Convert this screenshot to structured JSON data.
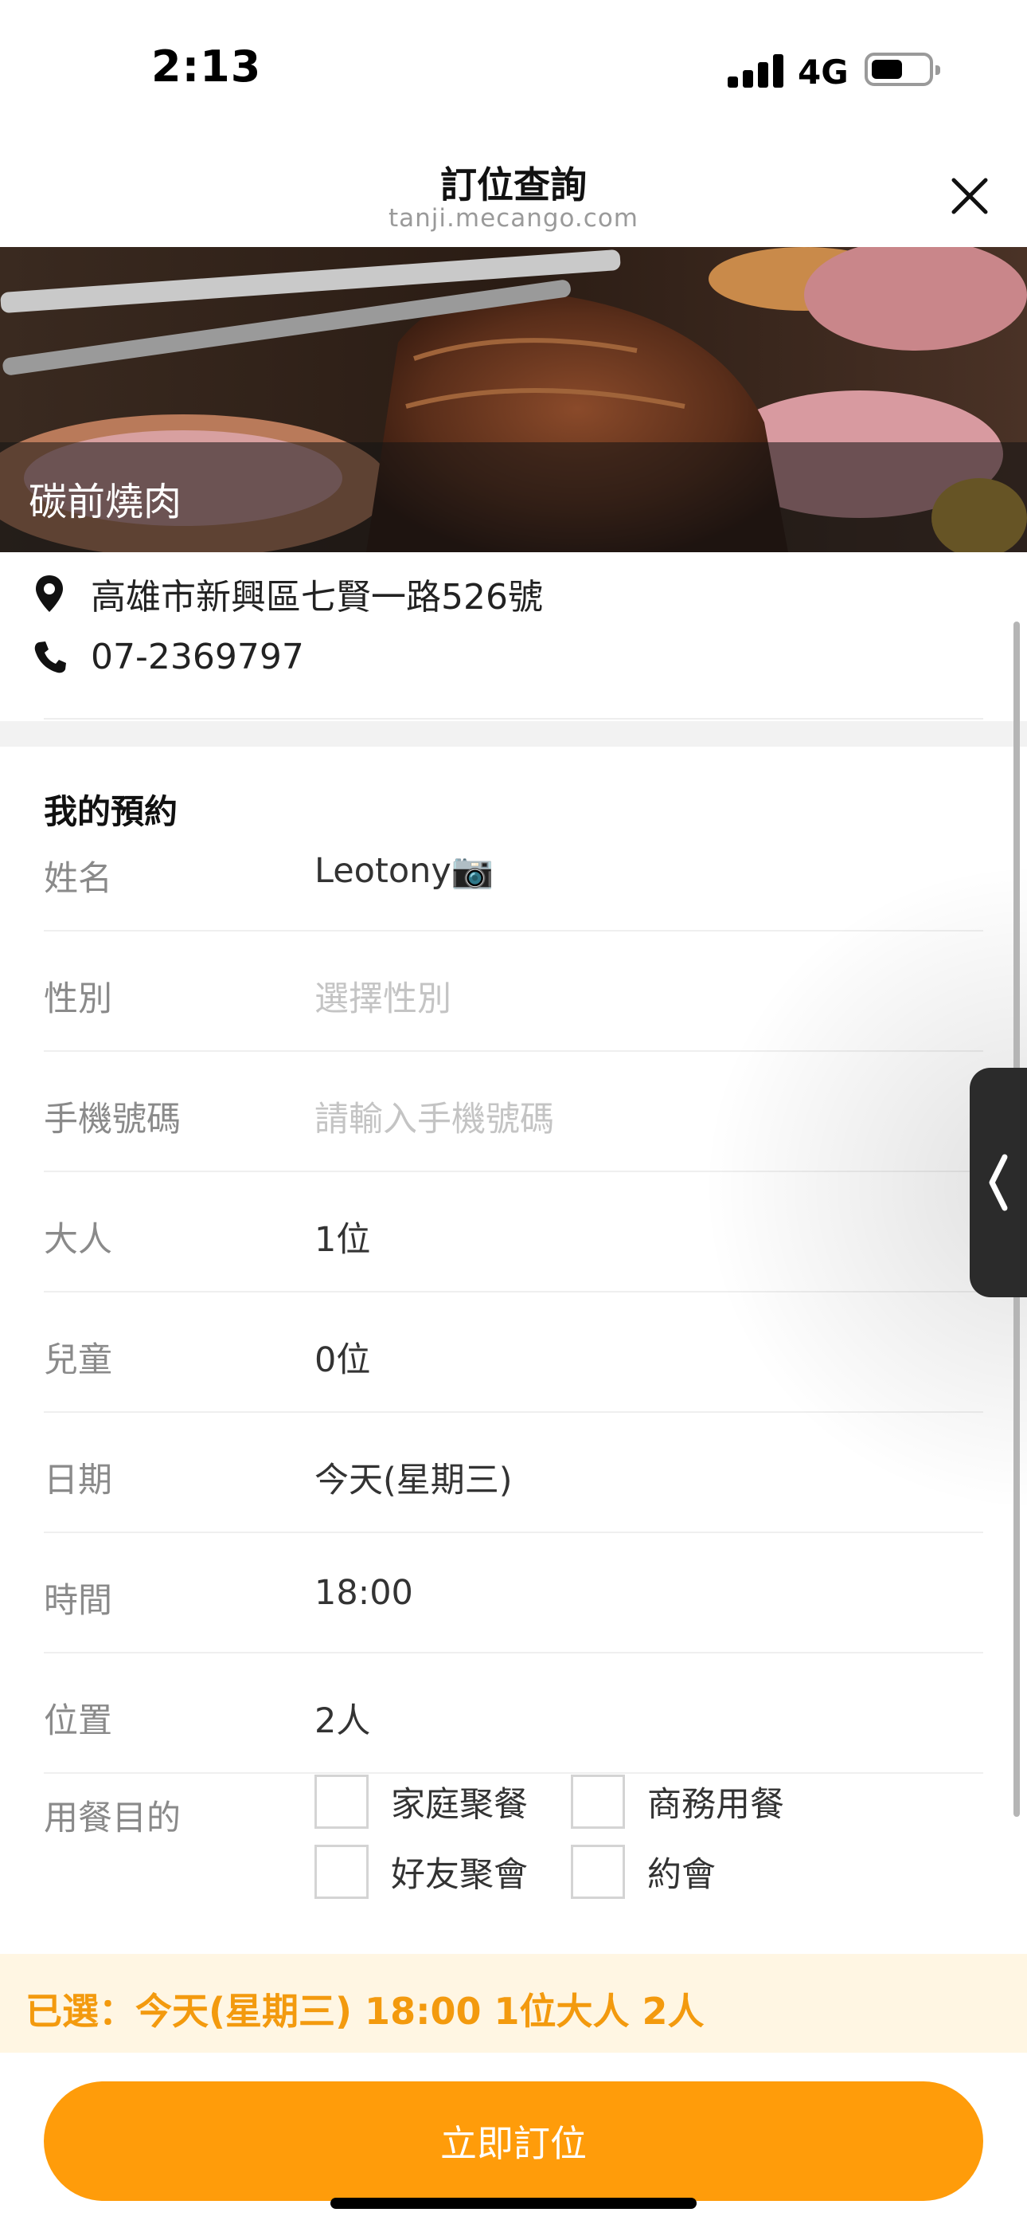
{
  "status_bar": {
    "time": "2:13",
    "network": "4G"
  },
  "header": {
    "title": "訂位查詢",
    "url": "tanji.mecango.com"
  },
  "restaurant": {
    "name": "碳前燒肉",
    "address": "高雄市新興區七賢一路526號",
    "phone": "07-2369797"
  },
  "reservation": {
    "section_title": "我的預約",
    "fields": [
      {
        "label": "姓名",
        "value": "Leotony📷",
        "placeholder": false
      },
      {
        "label": "性別",
        "value": "選擇性別",
        "placeholder": true
      },
      {
        "label": "手機號碼",
        "value": "請輸入手機號碼",
        "placeholder": true
      },
      {
        "label": "大人",
        "value": "1位",
        "placeholder": false
      },
      {
        "label": "兒童",
        "value": "0位",
        "placeholder": false
      },
      {
        "label": "日期",
        "value": "今天(星期三)",
        "placeholder": false
      },
      {
        "label": "時間",
        "value": "18:00",
        "placeholder": false
      },
      {
        "label": "位置",
        "value": "2人",
        "placeholder": false
      }
    ],
    "purpose": {
      "label": "用餐目的",
      "options": [
        {
          "label": "家庭聚餐",
          "checked": false
        },
        {
          "label": "商務用餐",
          "checked": false
        },
        {
          "label": "好友聚會",
          "checked": false
        },
        {
          "label": "約會",
          "checked": false
        }
      ]
    }
  },
  "summary": {
    "text": "已選：今天(星期三) 18:00 1位大人 2人"
  },
  "cta": {
    "label": "立即訂位"
  },
  "colors": {
    "accent": "#ff9c0a",
    "summary_text": "#f39a0e",
    "summary_bg": "#fff6e3"
  }
}
